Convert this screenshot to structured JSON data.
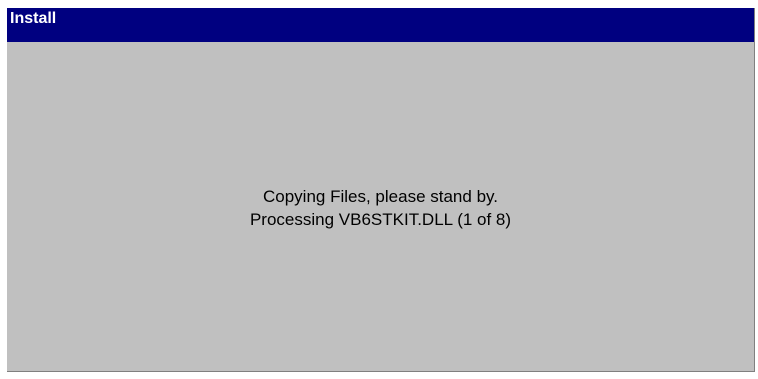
{
  "window": {
    "title": "Install",
    "title_bar_color": "#000080",
    "background_color": "#c0c0c0"
  },
  "status": {
    "line1": "Copying Files, please stand by.",
    "line2": "Processing VB6STKIT.DLL (1 of 8)"
  }
}
